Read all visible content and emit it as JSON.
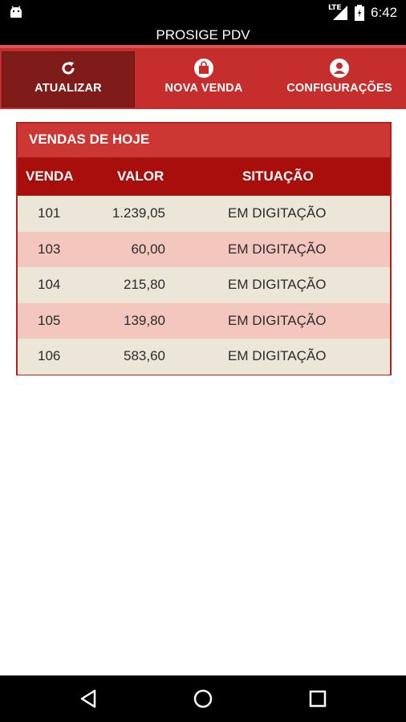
{
  "status_bar": {
    "network": "LTE",
    "time": "6:42",
    "icons": [
      "android-icon",
      "lte-signal-icon",
      "battery-icon"
    ]
  },
  "app": {
    "title": "PROSIGE PDV"
  },
  "toolbar": {
    "items": [
      {
        "label": "ATUALIZAR",
        "icon": "refresh-icon",
        "active": true
      },
      {
        "label": "NOVA VENDA",
        "icon": "shopping-bag-icon",
        "active": false
      },
      {
        "label": "CONFIGURAÇÕES",
        "icon": "user-icon",
        "active": false
      }
    ]
  },
  "sales": {
    "title": "VENDAS DE HOJE",
    "columns": [
      "VENDA",
      "VALOR",
      "SITUAÇÃO"
    ],
    "rows": [
      {
        "venda": "101",
        "valor": "1.239,05",
        "situacao": "EM DIGITAÇÃO"
      },
      {
        "venda": "103",
        "valor": "60,00",
        "situacao": "EM DIGITAÇÃO"
      },
      {
        "venda": "104",
        "valor": "215,80",
        "situacao": "EM DIGITAÇÃO"
      },
      {
        "venda": "105",
        "valor": "139,80",
        "situacao": "EM DIGITAÇÃO"
      },
      {
        "venda": "106",
        "valor": "583,60",
        "situacao": "EM DIGITAÇÃO"
      }
    ]
  },
  "nav_bar": {
    "icons": [
      "back-icon",
      "home-icon",
      "recents-icon"
    ]
  },
  "colors": {
    "primary": "#c62e2e",
    "active_tab": "#7f1c1a",
    "table_header": "#a80f0c",
    "row_alt": "#f3c6be",
    "row_base": "#ece6d8"
  }
}
